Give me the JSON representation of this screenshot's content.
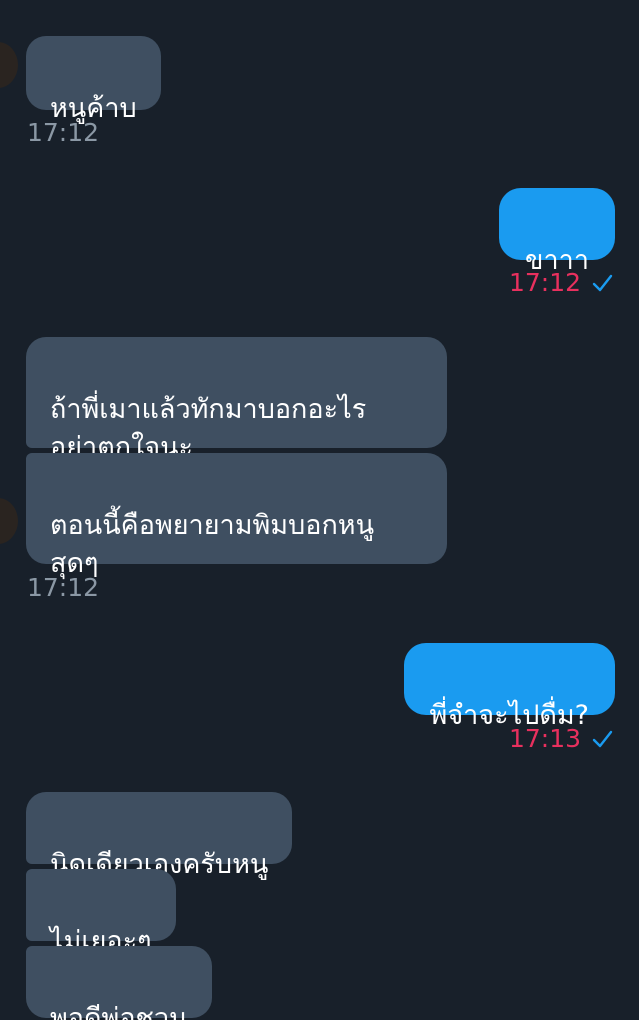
{
  "messages": {
    "m1": {
      "text": "หนูค้าบ",
      "time": "17:12"
    },
    "m2": {
      "text": "ขาาา",
      "time": "17:12"
    },
    "m3": {
      "text": "ถ้าพี่เมาแล้วทักมาบอกอะไร\nอย่าตกใจนะ"
    },
    "m4": {
      "text": "ตอนนี้คือพยายามพิมบอกหนู\nสุดๆ",
      "time": "17:12"
    },
    "m5": {
      "text": "พี่จำจะไปดื่ม?",
      "time": "17:13"
    },
    "m6": {
      "text": "นิดเดียวเองครับหนู"
    },
    "m7": {
      "text": "ไม่เยอะๆ"
    },
    "m8": {
      "text": "พอดีพ่อชวน"
    }
  },
  "colors": {
    "background": "#18202a",
    "incoming_bubble": "#3f4f61",
    "outgoing_bubble": "#1a9bf0",
    "outgoing_time": "#e8305e",
    "read_check": "#1a9bf0"
  },
  "icons": {
    "read_receipt": "checkmark-icon",
    "avatar": "avatar"
  }
}
